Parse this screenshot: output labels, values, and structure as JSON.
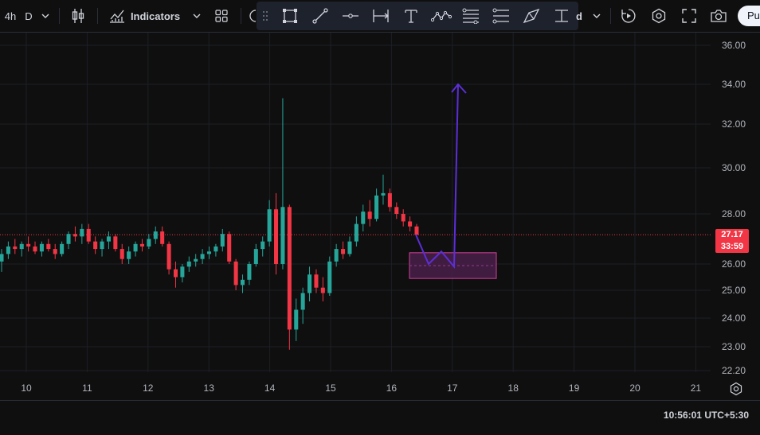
{
  "toolbar": {
    "interval": "4h",
    "interval2": "D",
    "indicators_label": "Indicators",
    "hidden_letter": "d",
    "publish_label": "Pu"
  },
  "price_axis": {
    "labels": [
      "36.00",
      "34.00",
      "32.00",
      "30.00",
      "28.00",
      "26.00",
      "25.00",
      "24.00",
      "23.00",
      "22.20"
    ],
    "current_price": "27.17",
    "countdown": "33:59"
  },
  "time_axis": {
    "labels": [
      "10",
      "11",
      "12",
      "13",
      "14",
      "15",
      "16",
      "17",
      "18",
      "19",
      "20",
      "21"
    ]
  },
  "status": {
    "clock": "10:56:01",
    "timezone": "UTC+5:30"
  },
  "colors": {
    "up": "#26a69a",
    "down": "#f23645",
    "drawing": "#5b2ed8",
    "zone_fill": "#4a1f4a",
    "zone_border": "#d0409a"
  },
  "chart_data": {
    "type": "candlestick",
    "symbol_interval": "4h",
    "ylim": [
      22.2,
      36.0
    ],
    "x_ticks": [
      "10",
      "11",
      "12",
      "13",
      "14",
      "15",
      "16",
      "17",
      "18",
      "19",
      "20",
      "21"
    ],
    "last_price": 27.17,
    "candles": [
      {
        "o": 26.1,
        "h": 26.6,
        "l": 25.7,
        "c": 26.4
      },
      {
        "o": 26.4,
        "h": 26.9,
        "l": 26.2,
        "c": 26.7
      },
      {
        "o": 26.7,
        "h": 27.0,
        "l": 26.4,
        "c": 26.6
      },
      {
        "o": 26.6,
        "h": 26.9,
        "l": 26.3,
        "c": 26.8
      },
      {
        "o": 26.8,
        "h": 27.1,
        "l": 26.5,
        "c": 26.7
      },
      {
        "o": 26.7,
        "h": 26.9,
        "l": 26.4,
        "c": 26.5
      },
      {
        "o": 26.5,
        "h": 26.9,
        "l": 26.3,
        "c": 26.8
      },
      {
        "o": 26.8,
        "h": 27.0,
        "l": 26.5,
        "c": 26.6
      },
      {
        "o": 26.6,
        "h": 26.8,
        "l": 26.2,
        "c": 26.4
      },
      {
        "o": 26.4,
        "h": 26.9,
        "l": 26.3,
        "c": 26.8
      },
      {
        "o": 26.8,
        "h": 27.3,
        "l": 26.6,
        "c": 27.2
      },
      {
        "o": 27.2,
        "h": 27.5,
        "l": 26.9,
        "c": 27.1
      },
      {
        "o": 27.1,
        "h": 27.6,
        "l": 26.8,
        "c": 27.4
      },
      {
        "o": 27.4,
        "h": 27.6,
        "l": 26.8,
        "c": 26.9
      },
      {
        "o": 26.9,
        "h": 27.1,
        "l": 26.4,
        "c": 26.6
      },
      {
        "o": 26.6,
        "h": 27.0,
        "l": 26.3,
        "c": 26.9
      },
      {
        "o": 26.9,
        "h": 27.3,
        "l": 26.6,
        "c": 27.1
      },
      {
        "o": 27.1,
        "h": 27.2,
        "l": 26.5,
        "c": 26.6
      },
      {
        "o": 26.6,
        "h": 26.8,
        "l": 26.0,
        "c": 26.2
      },
      {
        "o": 26.2,
        "h": 26.7,
        "l": 26.0,
        "c": 26.5
      },
      {
        "o": 26.5,
        "h": 26.9,
        "l": 26.3,
        "c": 26.8
      },
      {
        "o": 26.8,
        "h": 27.0,
        "l": 26.5,
        "c": 26.7
      },
      {
        "o": 26.7,
        "h": 27.2,
        "l": 26.6,
        "c": 27.0
      },
      {
        "o": 27.0,
        "h": 27.5,
        "l": 26.8,
        "c": 27.3
      },
      {
        "o": 27.3,
        "h": 27.5,
        "l": 26.7,
        "c": 26.8
      },
      {
        "o": 26.8,
        "h": 26.9,
        "l": 25.6,
        "c": 25.8
      },
      {
        "o": 25.8,
        "h": 26.1,
        "l": 25.1,
        "c": 25.5
      },
      {
        "o": 25.5,
        "h": 26.0,
        "l": 25.3,
        "c": 25.9
      },
      {
        "o": 25.9,
        "h": 26.3,
        "l": 25.7,
        "c": 26.1
      },
      {
        "o": 26.1,
        "h": 26.4,
        "l": 25.9,
        "c": 26.2
      },
      {
        "o": 26.2,
        "h": 26.6,
        "l": 26.0,
        "c": 26.4
      },
      {
        "o": 26.4,
        "h": 26.7,
        "l": 26.2,
        "c": 26.5
      },
      {
        "o": 26.5,
        "h": 26.8,
        "l": 26.3,
        "c": 26.7
      },
      {
        "o": 26.7,
        "h": 27.4,
        "l": 26.5,
        "c": 27.2
      },
      {
        "o": 27.2,
        "h": 27.3,
        "l": 26.0,
        "c": 26.1
      },
      {
        "o": 26.1,
        "h": 26.2,
        "l": 25.0,
        "c": 25.2
      },
      {
        "o": 25.2,
        "h": 25.6,
        "l": 24.9,
        "c": 25.4
      },
      {
        "o": 25.4,
        "h": 26.1,
        "l": 25.2,
        "c": 26.0
      },
      {
        "o": 26.0,
        "h": 26.8,
        "l": 25.9,
        "c": 26.6
      },
      {
        "o": 26.6,
        "h": 27.1,
        "l": 26.3,
        "c": 26.9
      },
      {
        "o": 26.9,
        "h": 28.6,
        "l": 26.7,
        "c": 28.2
      },
      {
        "o": 28.2,
        "h": 28.9,
        "l": 25.6,
        "c": 26.0
      },
      {
        "o": 26.0,
        "h": 33.3,
        "l": 25.8,
        "c": 28.3
      },
      {
        "o": 28.3,
        "h": 28.4,
        "l": 22.9,
        "c": 23.6
      },
      {
        "o": 23.6,
        "h": 24.7,
        "l": 23.2,
        "c": 24.3
      },
      {
        "o": 24.3,
        "h": 25.1,
        "l": 23.8,
        "c": 24.9
      },
      {
        "o": 24.9,
        "h": 25.9,
        "l": 24.6,
        "c": 25.6
      },
      {
        "o": 25.6,
        "h": 25.8,
        "l": 24.9,
        "c": 25.1
      },
      {
        "o": 25.1,
        "h": 25.5,
        "l": 24.6,
        "c": 24.9
      },
      {
        "o": 24.9,
        "h": 26.3,
        "l": 24.8,
        "c": 26.1
      },
      {
        "o": 26.1,
        "h": 26.8,
        "l": 25.9,
        "c": 26.6
      },
      {
        "o": 26.6,
        "h": 26.9,
        "l": 26.2,
        "c": 26.4
      },
      {
        "o": 26.4,
        "h": 27.1,
        "l": 26.3,
        "c": 26.9
      },
      {
        "o": 26.9,
        "h": 27.9,
        "l": 26.7,
        "c": 27.6
      },
      {
        "o": 27.6,
        "h": 28.4,
        "l": 27.3,
        "c": 28.1
      },
      {
        "o": 28.1,
        "h": 28.6,
        "l": 27.5,
        "c": 27.8
      },
      {
        "o": 27.8,
        "h": 29.1,
        "l": 27.7,
        "c": 28.8
      },
      {
        "o": 28.8,
        "h": 29.7,
        "l": 28.4,
        "c": 28.9
      },
      {
        "o": 28.9,
        "h": 29.1,
        "l": 28.1,
        "c": 28.3
      },
      {
        "o": 28.3,
        "h": 28.5,
        "l": 27.8,
        "c": 28.0
      },
      {
        "o": 28.0,
        "h": 28.2,
        "l": 27.5,
        "c": 27.7
      },
      {
        "o": 27.7,
        "h": 27.9,
        "l": 27.3,
        "c": 27.5
      },
      {
        "o": 27.5,
        "h": 27.6,
        "l": 27.1,
        "c": 27.17
      }
    ],
    "annotations": {
      "zone": {
        "price_top": 26.45,
        "price_bottom": 25.45
      },
      "path_points": [
        [
          27.17,
          "last"
        ],
        [
          26.0,
          "a"
        ],
        [
          26.5,
          "b"
        ],
        [
          25.9,
          "c"
        ],
        [
          34.0,
          "d"
        ]
      ]
    }
  }
}
